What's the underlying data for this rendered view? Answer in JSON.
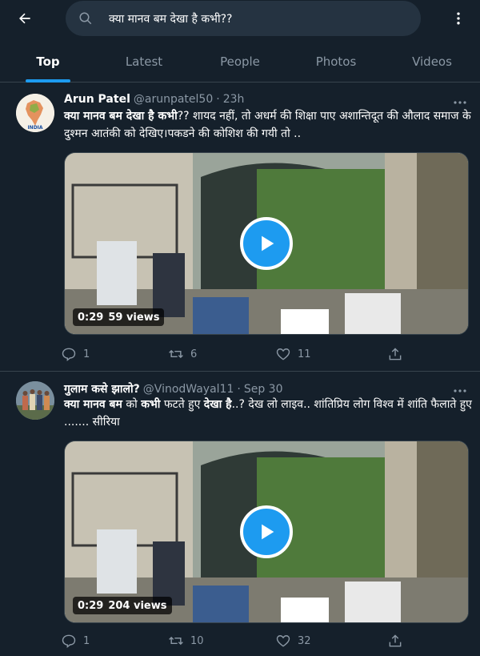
{
  "search": {
    "query": "क्या मानव बम देखा है कभी??"
  },
  "tabs": [
    {
      "label": "Top",
      "active": true
    },
    {
      "label": "Latest",
      "active": false
    },
    {
      "label": "People",
      "active": false
    },
    {
      "label": "Photos",
      "active": false
    },
    {
      "label": "Videos",
      "active": false
    }
  ],
  "tweets": [
    {
      "name": "Arun Patel",
      "handle": "@arunpatel50",
      "dot": "·",
      "time": "23h",
      "text_segments": [
        {
          "bold": true,
          "text": "क्या मानव बम देखा है कभी"
        },
        {
          "bold": false,
          "text": "?? शायद नहीं, तो  अधर्म की शिक्षा पाए अशान्तिदूत की औलाद समाज के दुश्मन आतंकी को देखिए।पकडने की कोशिश की गयी तो .."
        }
      ],
      "video": {
        "duration": "0:29",
        "views": "59 views"
      },
      "stats": {
        "replies": "1",
        "retweets": "6",
        "likes": "11"
      },
      "avatar_text": "INDIA"
    },
    {
      "name": "गुलाम कसे झालो?",
      "handle": "@VinodWayal11",
      "dot": "·",
      "time": "Sep 30",
      "text_segments": [
        {
          "bold": true,
          "text": "क्या मानव बम"
        },
        {
          "bold": false,
          "text": " को "
        },
        {
          "bold": true,
          "text": "कभी"
        },
        {
          "bold": false,
          "text": " फटते हुए "
        },
        {
          "bold": true,
          "text": "देखा है"
        },
        {
          "bold": false,
          "text": "..? देख लो लाइव.. शांतिप्रिय लोग विश्व में शांति फैलाते हुए ....... सीरिया"
        }
      ],
      "video": {
        "duration": "0:29",
        "views": "204 views"
      },
      "stats": {
        "replies": "1",
        "retweets": "10",
        "likes": "32"
      }
    }
  ],
  "colors": {
    "background": "#15202b",
    "accent": "#1d9bf0",
    "muted": "#8b98a5",
    "divider": "#38444d"
  },
  "icons": [
    "back-arrow-icon",
    "search-icon",
    "more-icon",
    "play-icon",
    "reply-icon",
    "retweet-icon",
    "like-icon",
    "share-icon"
  ]
}
